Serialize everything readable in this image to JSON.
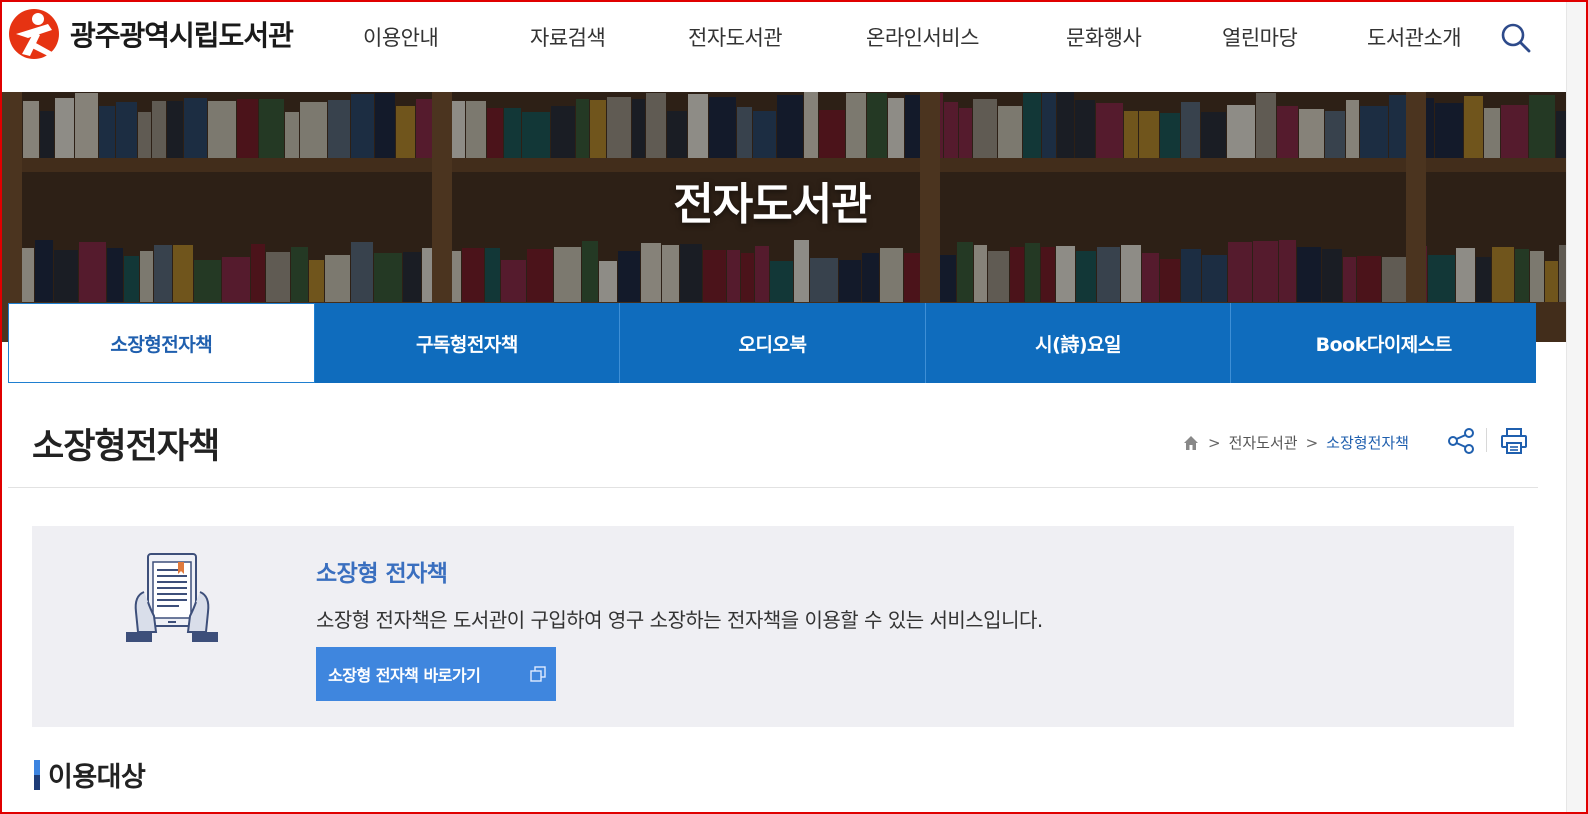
{
  "header": {
    "logo_text": "광주광역시립도서관",
    "nav": [
      "이용안내",
      "자료검색",
      "전자도서관",
      "온라인서비스",
      "문화행사",
      "열린마당",
      "도서관소개"
    ]
  },
  "hero": {
    "title": "전자도서관"
  },
  "tabs": [
    {
      "label": "소장형전자책",
      "active": true
    },
    {
      "label": "구독형전자책",
      "active": false
    },
    {
      "label": "오디오북",
      "active": false
    },
    {
      "label": "시(詩)요일",
      "active": false
    },
    {
      "label": "Book다이제스트",
      "active": false
    }
  ],
  "page": {
    "title": "소장형전자책",
    "breadcrumb": {
      "level1": "전자도서관",
      "current": "소장형전자책"
    }
  },
  "info": {
    "title": "소장형 전자책",
    "description": "소장형 전자책은 도서관이 구입하여 영구 소장하는 전자책을 이용할 수 있는 서비스입니다.",
    "link_label": "소장형 전자책 바로가기"
  },
  "section": {
    "title": "이용대상"
  },
  "colors": {
    "primary_blue": "#0f6cbd",
    "active_text": "#1f5fae",
    "link_button": "#3f86de",
    "logo_red": "#e63312"
  },
  "icons": [
    "search-icon",
    "home-icon",
    "share-icon",
    "print-icon",
    "external-link-icon",
    "tablet-book-icon"
  ]
}
